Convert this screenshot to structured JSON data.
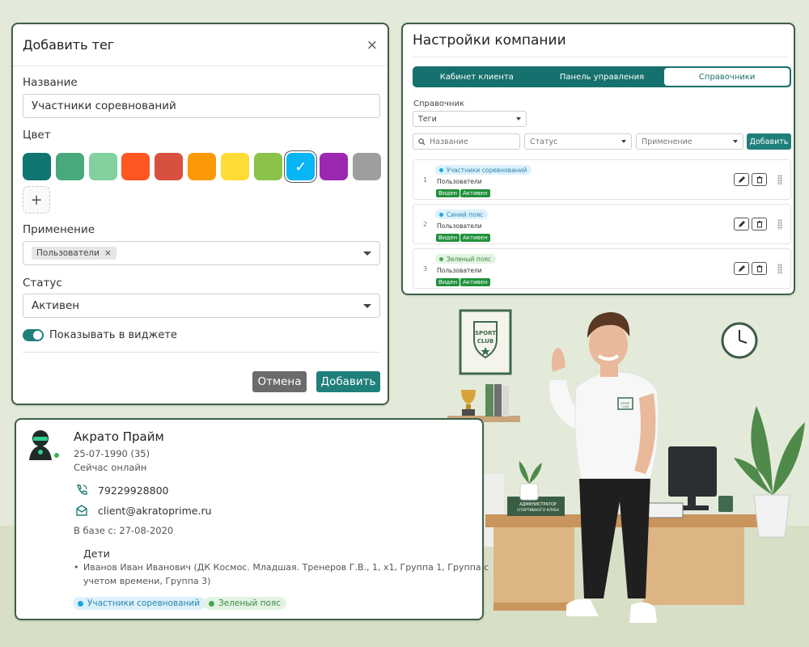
{
  "colors": {
    "accent": "#1f7f7a",
    "cancel": "#6b6b6b",
    "success_badge": "#21913c"
  },
  "add_tag_dialog": {
    "title": "Добавить тег",
    "close_icon": "close-icon",
    "name_label": "Название",
    "name_value": "Участники соревнований",
    "color_label": "Цвет",
    "swatches": [
      {
        "color": "#0f7672",
        "selected": false
      },
      {
        "color": "#48a97c",
        "selected": false
      },
      {
        "color": "#82d09e",
        "selected": false
      },
      {
        "color": "#ff5622",
        "selected": false
      },
      {
        "color": "#d85040",
        "selected": false
      },
      {
        "color": "#fb9a06",
        "selected": false
      },
      {
        "color": "#ffdb35",
        "selected": false
      },
      {
        "color": "#8bc24a",
        "selected": false
      },
      {
        "color": "#08b5f5",
        "selected": true
      },
      {
        "color": "#9c27b0",
        "selected": false
      },
      {
        "color": "#9e9e9e",
        "selected": false
      }
    ],
    "add_color_symbol": "+",
    "usage_label": "Применение",
    "usage_chip": "Пользователи",
    "usage_chip_remove": "×",
    "status_label": "Статус",
    "status_value": "Активен",
    "widget_toggle_on": true,
    "widget_toggle_label": "Показывать в виджете",
    "cancel_label": "Отмена",
    "submit_label": "Добавить"
  },
  "company_settings": {
    "title": "Настройки компании",
    "tabs": [
      {
        "label": "Кабинет клиента",
        "active": false
      },
      {
        "label": "Панель управления",
        "active": false
      },
      {
        "label": "Справочники",
        "active": true
      }
    ],
    "directory_label": "Справочник",
    "directory_value": "Теги",
    "filters": {
      "name_placeholder": "Название",
      "status_placeholder": "Статус",
      "usage_placeholder": "Применение",
      "add_label": "Добавить"
    },
    "rows": [
      {
        "num": "1",
        "tag": "Участники соревнований",
        "tag_bg": "#dcf1fb",
        "tag_dot": "#1ba6e0",
        "tag_fg": "#2b85b0",
        "scope": "Пользователи",
        "badges": [
          "Виден",
          "Активен"
        ]
      },
      {
        "num": "2",
        "tag": "Синий пояс",
        "tag_bg": "#dcf1fb",
        "tag_dot": "#1ba6e0",
        "tag_fg": "#2b85b0",
        "scope": "Пользователи",
        "badges": [
          "Виден",
          "Активен"
        ]
      },
      {
        "num": "3",
        "tag": "Зеленый пояс",
        "tag_bg": "#e2f3e2",
        "tag_dot": "#47a553",
        "tag_fg": "#3d8a46",
        "scope": "Пользователи",
        "badges": [
          "Виден",
          "Активен"
        ]
      }
    ]
  },
  "client_card": {
    "name": "Акрато Прайм",
    "birth": "25-07-1990 (35)",
    "online_status": "Сейчас онлайн",
    "phone": "79229928800",
    "email": "client@akratoprime.ru",
    "since": "В базе с: 27-08-2020",
    "children_label": "Дети",
    "child_line1": "Иванов Иван Иванович (ДК Космос. Младшая. Тренеров Г.В., 1, х1, Группа 1, Группа с",
    "child_line2": "учетом времени, Группа 3)",
    "tags": [
      {
        "label": "Участники соревнований",
        "bg": "#dcf1fb",
        "dot": "#1ba6e0",
        "fg": "#2b85b0"
      },
      {
        "label": "Зеленый пояс",
        "bg": "#e2f3e2",
        "dot": "#47a553",
        "fg": "#3d8a46"
      }
    ]
  },
  "scene": {
    "poster_line1": "SPORT",
    "poster_line2": "CLUB",
    "desk_sign_line1": "АДМИНИСТРАТОР",
    "desk_sign_line2": "СПОРТИВНОГО КЛУБА",
    "shirt_logo_line1": "SPORT",
    "shirt_logo_line2": "CLUB"
  }
}
